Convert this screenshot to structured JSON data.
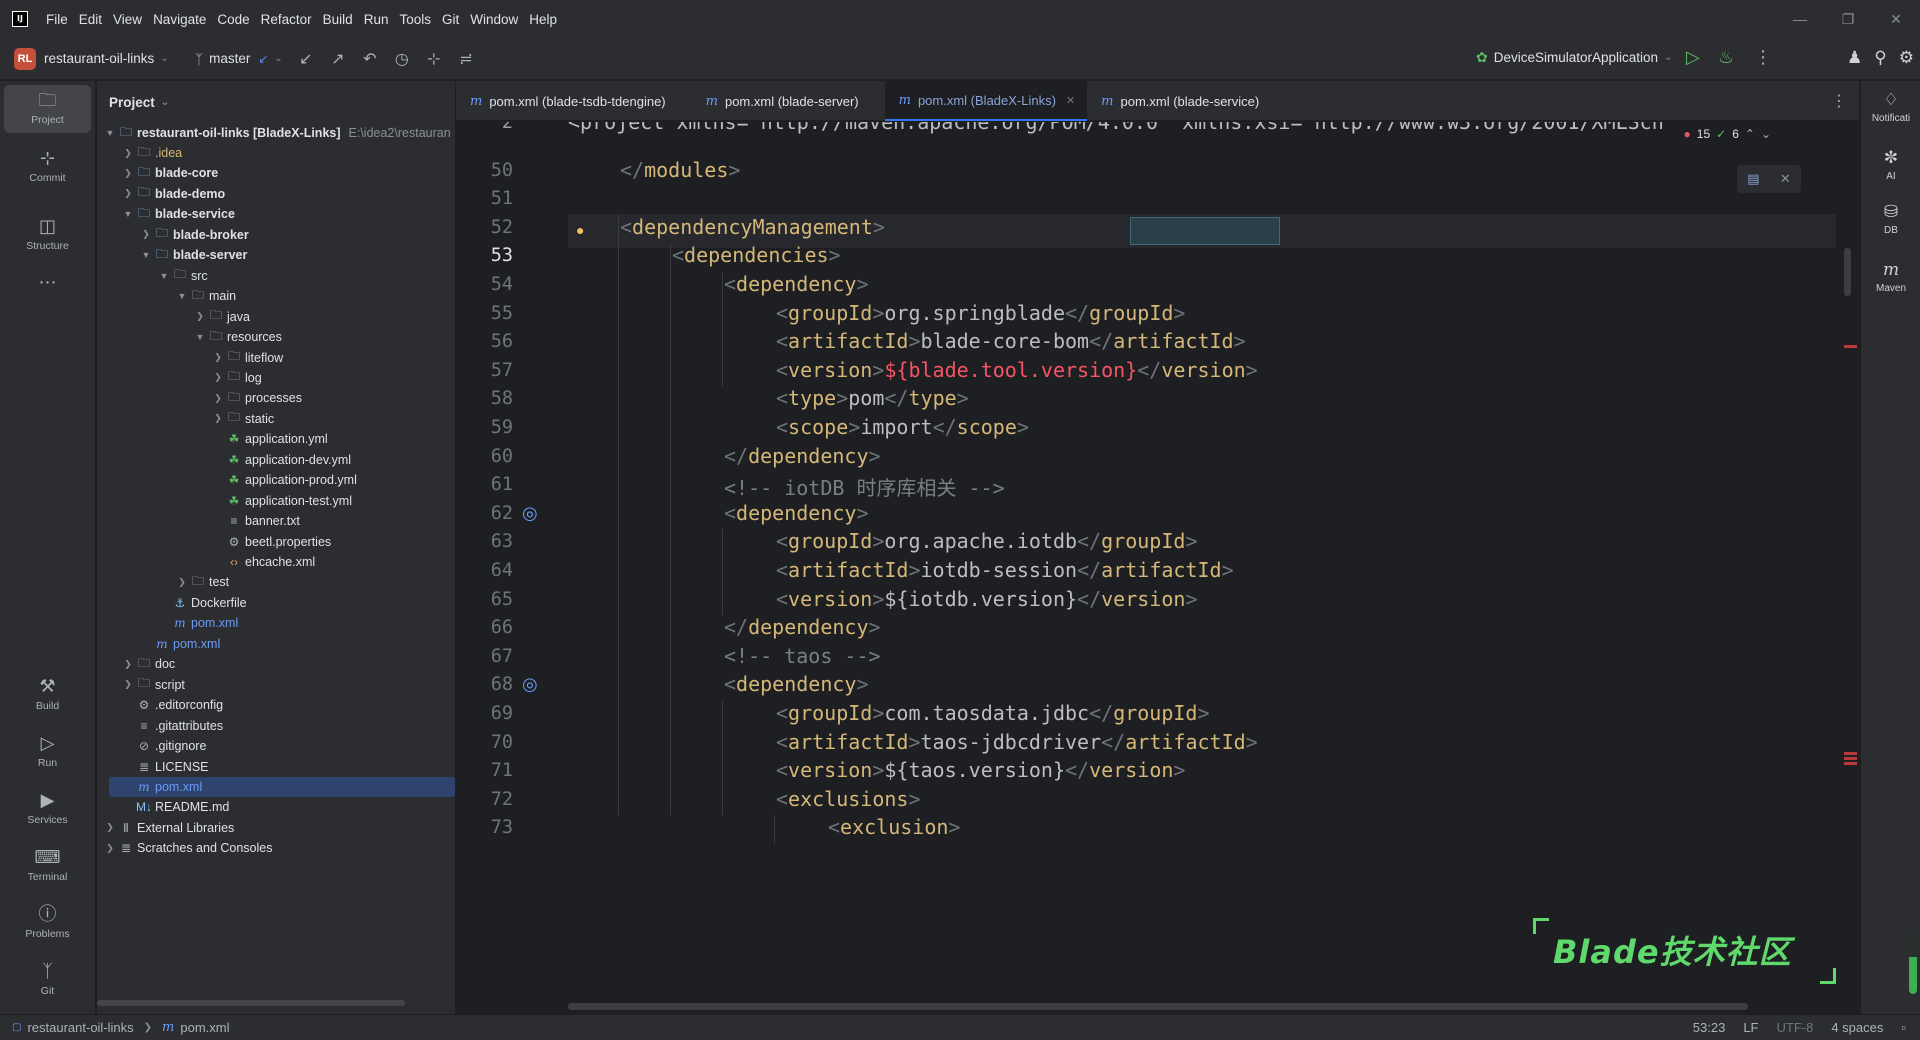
{
  "menu": [
    "File",
    "Edit",
    "View",
    "Navigate",
    "Code",
    "Refactor",
    "Build",
    "Run",
    "Tools",
    "Git",
    "Window",
    "Help"
  ],
  "toolbar": {
    "project_badge": "RL",
    "project_name": "restaurant-oil-links",
    "branch": "master",
    "run_config": "DeviceSimulatorApplication"
  },
  "left_strip": [
    {
      "label": "Project",
      "icon": "folder-icon"
    },
    {
      "label": "Commit",
      "icon": "commit-icon"
    },
    {
      "label": "Structure",
      "icon": "structure-icon"
    },
    {
      "label": "",
      "icon": "more-icon"
    },
    {
      "label": "Build",
      "icon": "hammer-icon"
    },
    {
      "label": "Run",
      "icon": "run-icon"
    },
    {
      "label": "Services",
      "icon": "services-icon"
    },
    {
      "label": "Terminal",
      "icon": "terminal-icon"
    },
    {
      "label": "Problems",
      "icon": "problems-icon"
    },
    {
      "label": "Git",
      "icon": "git-icon"
    }
  ],
  "project_panel": {
    "title": "Project",
    "root_name": "restaurant-oil-links [BladeX-Links]",
    "root_path": "E:\\idea2\\restauran",
    "tree": [
      {
        "name": ".idea",
        "depth": 1,
        "arrow": "right",
        "icon": "folder"
      },
      {
        "name": "blade-core",
        "depth": 1,
        "arrow": "right",
        "icon": "module",
        "bold": true
      },
      {
        "name": "blade-demo",
        "depth": 1,
        "arrow": "right",
        "icon": "module",
        "bold": true
      },
      {
        "name": "blade-service",
        "depth": 1,
        "arrow": "down",
        "icon": "module",
        "bold": true
      },
      {
        "name": "blade-broker",
        "depth": 2,
        "arrow": "right",
        "icon": "module",
        "bold": true
      },
      {
        "name": "blade-server",
        "depth": 2,
        "arrow": "down",
        "icon": "module",
        "bold": true
      },
      {
        "name": "src",
        "depth": 3,
        "arrow": "down",
        "icon": "folder"
      },
      {
        "name": "main",
        "depth": 4,
        "arrow": "down",
        "icon": "folder"
      },
      {
        "name": "java",
        "depth": 5,
        "arrow": "right",
        "icon": "folder"
      },
      {
        "name": "resources",
        "depth": 5,
        "arrow": "down",
        "icon": "folder"
      },
      {
        "name": "liteflow",
        "depth": 6,
        "arrow": "right",
        "icon": "folder"
      },
      {
        "name": "log",
        "depth": 6,
        "arrow": "right",
        "icon": "folder"
      },
      {
        "name": "processes",
        "depth": 6,
        "arrow": "right",
        "icon": "folder"
      },
      {
        "name": "static",
        "depth": 6,
        "arrow": "right",
        "icon": "folder"
      },
      {
        "name": "application.yml",
        "depth": 6,
        "arrow": "",
        "icon": "yml"
      },
      {
        "name": "application-dev.yml",
        "depth": 6,
        "arrow": "",
        "icon": "yml"
      },
      {
        "name": "application-prod.yml",
        "depth": 6,
        "arrow": "",
        "icon": "yml"
      },
      {
        "name": "application-test.yml",
        "depth": 6,
        "arrow": "",
        "icon": "yml"
      },
      {
        "name": "banner.txt",
        "depth": 6,
        "arrow": "",
        "icon": "txt"
      },
      {
        "name": "beetl.properties",
        "depth": 6,
        "arrow": "",
        "icon": "props"
      },
      {
        "name": "ehcache.xml",
        "depth": 6,
        "arrow": "",
        "icon": "xml"
      },
      {
        "name": "test",
        "depth": 4,
        "arrow": "right",
        "icon": "folder"
      },
      {
        "name": "Dockerfile",
        "depth": 3,
        "arrow": "",
        "icon": "docker"
      },
      {
        "name": "pom.xml",
        "depth": 3,
        "arrow": "",
        "icon": "m"
      },
      {
        "name": "pom.xml",
        "depth": 2,
        "arrow": "",
        "icon": "m"
      },
      {
        "name": "doc",
        "depth": 1,
        "arrow": "right",
        "icon": "folder"
      },
      {
        "name": "script",
        "depth": 1,
        "arrow": "right",
        "icon": "folder"
      },
      {
        "name": ".editorconfig",
        "depth": 1,
        "arrow": "",
        "icon": "props"
      },
      {
        "name": ".gitattributes",
        "depth": 1,
        "arrow": "",
        "icon": "txt"
      },
      {
        "name": ".gitignore",
        "depth": 1,
        "arrow": "",
        "icon": "ignore"
      },
      {
        "name": "LICENSE",
        "depth": 1,
        "arrow": "",
        "icon": "license"
      },
      {
        "name": "pom.xml",
        "depth": 1,
        "arrow": "",
        "icon": "m",
        "selected": true
      },
      {
        "name": "README.md",
        "depth": 1,
        "arrow": "",
        "icon": "md"
      },
      {
        "name": "External Libraries",
        "depth": 0,
        "arrow": "right",
        "icon": "libs"
      },
      {
        "name": "Scratches and Consoles",
        "depth": 0,
        "arrow": "right",
        "icon": "scratch"
      }
    ]
  },
  "tabs": [
    {
      "label": "pom.xml (blade-tsdb-tdengine)",
      "active": false
    },
    {
      "label": "pom.xml (blade-server)",
      "active": false
    },
    {
      "label": "pom.xml (BladeX-Links)",
      "active": true
    },
    {
      "label": "pom.xml (blade-service)",
      "active": false
    }
  ],
  "editor": {
    "sticky_line_number": "2",
    "sticky_line": "<project xmlns=\"http://maven.apache.org/POM/4.0.0\" xmlns:xsi=\"http://www.w3.org/2001/XMLSch",
    "inspection": {
      "errors": "15",
      "warnings": "6"
    },
    "current_line": "53",
    "lines": [
      {
        "n": "50",
        "indent": 1,
        "kind": "close",
        "tag": "modules"
      },
      {
        "n": "51",
        "indent": 0,
        "kind": "blank"
      },
      {
        "n": "52",
        "indent": 1,
        "kind": "open",
        "tag": "dependencyManagement"
      },
      {
        "n": "53",
        "indent": 2,
        "kind": "open",
        "tag": "dependencies"
      },
      {
        "n": "54",
        "indent": 3,
        "kind": "open",
        "tag": "dependency"
      },
      {
        "n": "55",
        "indent": 4,
        "kind": "elem",
        "tag": "groupId",
        "text": "org.springblade"
      },
      {
        "n": "56",
        "indent": 4,
        "kind": "elem",
        "tag": "artifactId",
        "text": "blade-core-bom"
      },
      {
        "n": "57",
        "indent": 4,
        "kind": "elem",
        "tag": "version",
        "text": "${blade.tool.version}",
        "error": true
      },
      {
        "n": "58",
        "indent": 4,
        "kind": "elem",
        "tag": "type",
        "text": "pom"
      },
      {
        "n": "59",
        "indent": 4,
        "kind": "elem",
        "tag": "scope",
        "text": "import"
      },
      {
        "n": "60",
        "indent": 3,
        "kind": "close",
        "tag": "dependency"
      },
      {
        "n": "61",
        "indent": 3,
        "kind": "comment",
        "text": "<!-- iotDB 时序库相关 -->"
      },
      {
        "n": "62",
        "indent": 3,
        "kind": "open",
        "tag": "dependency"
      },
      {
        "n": "63",
        "indent": 4,
        "kind": "elem",
        "tag": "groupId",
        "text": "org.apache.iotdb"
      },
      {
        "n": "64",
        "indent": 4,
        "kind": "elem",
        "tag": "artifactId",
        "text": "iotdb-session"
      },
      {
        "n": "65",
        "indent": 4,
        "kind": "elem",
        "tag": "version",
        "text": "${iotdb.version}"
      },
      {
        "n": "66",
        "indent": 3,
        "kind": "close",
        "tag": "dependency"
      },
      {
        "n": "67",
        "indent": 3,
        "kind": "comment",
        "text": "<!-- taos -->"
      },
      {
        "n": "68",
        "indent": 3,
        "kind": "open",
        "tag": "dependency"
      },
      {
        "n": "69",
        "indent": 4,
        "kind": "elem",
        "tag": "groupId",
        "text": "com.taosdata.jdbc"
      },
      {
        "n": "70",
        "indent": 4,
        "kind": "elem",
        "tag": "artifactId",
        "text": "taos-jdbcdriver"
      },
      {
        "n": "71",
        "indent": 4,
        "kind": "elem",
        "tag": "version",
        "text": "${taos.version}"
      },
      {
        "n": "72",
        "indent": 4,
        "kind": "open",
        "tag": "exclusions"
      },
      {
        "n": "73",
        "indent": 5,
        "kind": "open",
        "tag": "exclusion"
      }
    ]
  },
  "watermark": "Blade技术社区",
  "right_strip": [
    {
      "label": "Notificati",
      "icon": "bell-icon"
    },
    {
      "label": "AI",
      "icon": "ai-icon"
    },
    {
      "label": "DB",
      "icon": "database-icon"
    },
    {
      "label": "Maven",
      "icon": "maven-icon"
    }
  ],
  "memory_fraction": 0.6,
  "statusbar": {
    "project": "restaurant-oil-links",
    "file": "pom.xml",
    "position": "53:23",
    "line_sep": "LF",
    "encoding": "UTF-8",
    "indent": "4 spaces"
  }
}
